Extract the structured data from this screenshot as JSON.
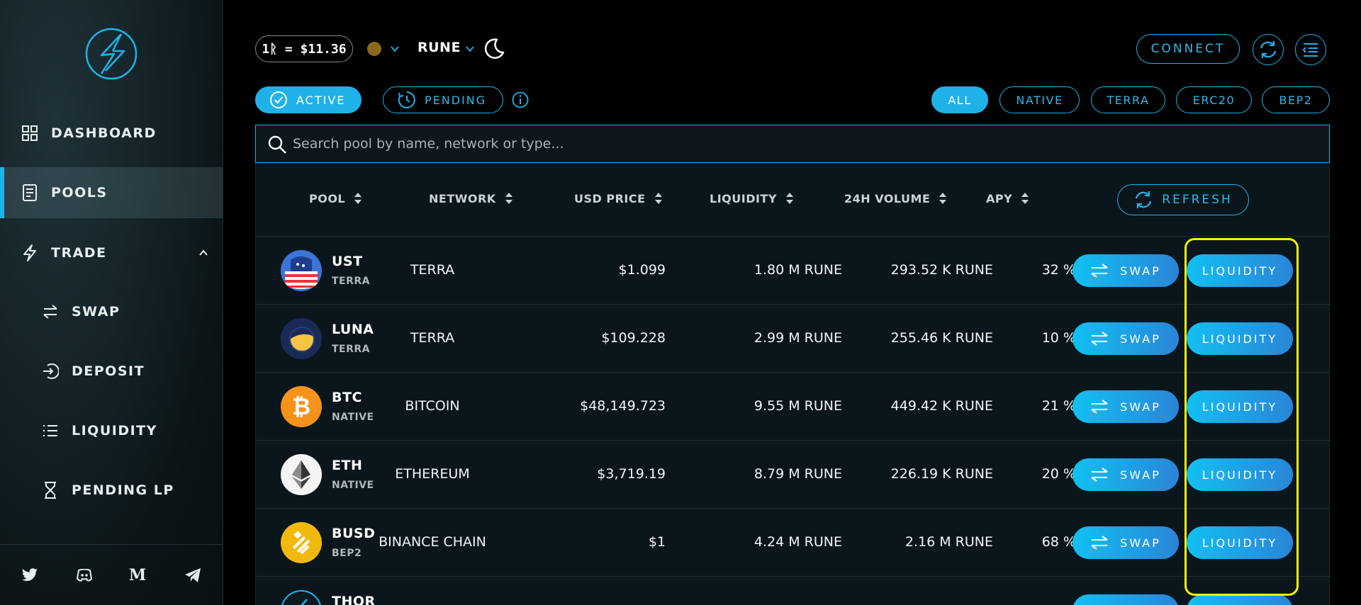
{
  "sidebar": {
    "items": [
      {
        "label": "DASHBOARD",
        "icon": "grid-icon"
      },
      {
        "label": "POOLS",
        "icon": "document-icon",
        "active": true
      },
      {
        "label": "TRADE",
        "icon": "lightning-icon",
        "expanded": true
      },
      {
        "label": "SWAP",
        "icon": "swap-arrows-icon"
      },
      {
        "label": "DEPOSIT",
        "icon": "deposit-icon"
      },
      {
        "label": "LIQUIDITY",
        "icon": "list-icon"
      },
      {
        "label": "PENDING LP",
        "icon": "hourglass-icon"
      }
    ],
    "social": [
      "twitter-icon",
      "discord-icon",
      "medium-icon",
      "telegram-icon"
    ]
  },
  "header": {
    "price": "1ᚱ = $11.36",
    "currency": "RUNE",
    "connect_label": "CONNECT"
  },
  "filters": {
    "status_tabs": [
      {
        "label": "ACTIVE",
        "selected": true
      },
      {
        "label": "PENDING",
        "selected": false
      }
    ],
    "types": [
      {
        "label": "ALL",
        "selected": true
      },
      {
        "label": "NATIVE",
        "selected": false
      },
      {
        "label": "TERRA",
        "selected": false
      },
      {
        "label": "ERC20",
        "selected": false
      },
      {
        "label": "BEP2",
        "selected": false
      }
    ]
  },
  "search": {
    "placeholder": "Search pool by name, network or type..."
  },
  "table": {
    "columns": [
      "POOL",
      "NETWORK",
      "USD PRICE",
      "LIQUIDITY",
      "24H VOLUME",
      "APY"
    ],
    "refresh_label": "REFRESH",
    "swap_label": "SWAP",
    "liquidity_label": "LIQUIDITY",
    "rows": [
      {
        "asset": "UST",
        "chain": "TERRA",
        "network": "TERRA",
        "price": "$1.099",
        "liquidity": "1.80 M RUNE",
        "volume": "293.52 K RUNE",
        "apy": "32 %"
      },
      {
        "asset": "LUNA",
        "chain": "TERRA",
        "network": "TERRA",
        "price": "$109.228",
        "liquidity": "2.99 M RUNE",
        "volume": "255.46 K RUNE",
        "apy": "10 %"
      },
      {
        "asset": "BTC",
        "chain": "NATIVE",
        "network": "BITCOIN",
        "price": "$48,149.723",
        "liquidity": "9.55 M RUNE",
        "volume": "449.42 K RUNE",
        "apy": "21 %"
      },
      {
        "asset": "ETH",
        "chain": "NATIVE",
        "network": "ETHEREUM",
        "price": "$3,719.19",
        "liquidity": "8.79 M RUNE",
        "volume": "226.19 K RUNE",
        "apy": "20 %"
      },
      {
        "asset": "BUSD",
        "chain": "BEP2",
        "network": "BINANCE CHAIN",
        "price": "$1",
        "liquidity": "4.24 M RUNE",
        "volume": "2.16 M RUNE",
        "apy": "68 %"
      },
      {
        "asset": "THOR",
        "chain": "",
        "network": "",
        "price": "",
        "liquidity": "",
        "volume": "",
        "apy": ""
      }
    ]
  },
  "colors": {
    "accent": "#1fb2e8",
    "highlight": "#f4f200"
  }
}
